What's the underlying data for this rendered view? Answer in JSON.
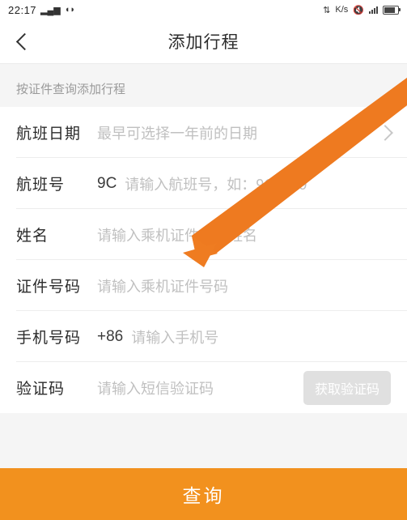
{
  "status_bar": {
    "time": "22:17",
    "left_icons": [
      "signal-icon",
      "wifi-dot-icon"
    ],
    "right_icons": [
      "kb-speed-icon",
      "mute-icon",
      "signal-bars-icon",
      "battery-icon"
    ],
    "speed_label": "K/s"
  },
  "nav": {
    "back_icon": "back-chevron-icon",
    "title": "添加行程"
  },
  "section": {
    "hint": "按证件查询添加行程"
  },
  "form": {
    "rows": [
      {
        "label": "航班日期",
        "prefix": "",
        "placeholder": "最早可选择一年前的日期",
        "trailing": "arrow"
      },
      {
        "label": "航班号",
        "prefix": "9C",
        "placeholder": "请输入航班号，如：9C5689",
        "trailing": "none"
      },
      {
        "label": "姓名",
        "prefix": "",
        "placeholder": "请输入乘机证件上的姓名",
        "trailing": "none"
      },
      {
        "label": "证件号码",
        "prefix": "",
        "placeholder": "请输入乘机证件号码",
        "trailing": "none"
      },
      {
        "label": "手机号码",
        "prefix": "+86",
        "placeholder": "请输入手机号",
        "trailing": "none"
      },
      {
        "label": "验证码",
        "prefix": "",
        "placeholder": "请输入短信验证码",
        "trailing": "button",
        "button_label": "获取验证码"
      }
    ]
  },
  "submit": {
    "label": "查询"
  },
  "annotation": {
    "arrow_color": "#f07a22",
    "arrow_name": "orange-pointer-arrow"
  },
  "colors": {
    "accent": "#f2911e",
    "arrow": "#f07a22",
    "page_bg": "#f5f5f5",
    "card_bg": "#ffffff",
    "placeholder": "#c0c0c0"
  }
}
